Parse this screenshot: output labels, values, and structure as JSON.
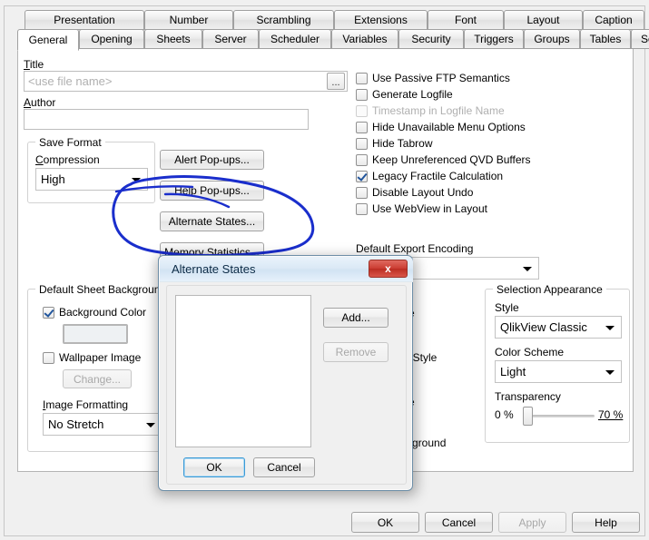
{
  "window": {
    "tabs_row1": [
      "Presentation",
      "Number",
      "Scrambling",
      "Extensions",
      "Font",
      "Layout",
      "Caption"
    ],
    "tabs_row2": [
      "General",
      "Opening",
      "Sheets",
      "Server",
      "Scheduler",
      "Variables",
      "Security",
      "Triggers",
      "Groups",
      "Tables",
      "Sort"
    ],
    "active_tab": "General"
  },
  "general": {
    "title_label": "Title",
    "title_placeholder": "<use file name>",
    "title_value": "",
    "browse_label": "...",
    "author_label": "Author",
    "author_value": "",
    "save_format": {
      "group_label": "Save Format",
      "compression_label": "Compression",
      "compression_value": "High"
    },
    "buttons": [
      "Alert Pop-ups...",
      "Help Pop-ups...",
      "Alternate States...",
      "Memory Statistics..."
    ]
  },
  "options": [
    {
      "label": "Use Passive FTP Semantics",
      "checked": false,
      "disabled": false
    },
    {
      "label": "Generate Logfile",
      "checked": false,
      "disabled": false
    },
    {
      "label": "Timestamp in Logfile Name",
      "checked": false,
      "disabled": true
    },
    {
      "label": "Hide Unavailable Menu Options",
      "checked": false,
      "disabled": false
    },
    {
      "label": "Hide Tabrow",
      "checked": false,
      "disabled": false
    },
    {
      "label": "Keep Unreferenced QVD Buffers",
      "checked": false,
      "disabled": false
    },
    {
      "label": "Legacy Fractile Calculation",
      "checked": true,
      "disabled": false
    },
    {
      "label": "Disable Layout Undo",
      "checked": false,
      "disabled": false
    },
    {
      "label": "Use WebView in Layout",
      "checked": false,
      "disabled": false
    }
  ],
  "export_encoding": {
    "label": "Default Export Encoding",
    "value": ""
  },
  "sheet_background": {
    "group_label": "Default Sheet Background",
    "background_color_label": "Background Color",
    "background_color_checked": true,
    "wallpaper_label": "Wallpaper Image",
    "wallpaper_checked": false,
    "change_label": "Change...",
    "change_disabled": true,
    "image_formatting_label": "Image Formatting",
    "image_formatting_value": "No Stretch"
  },
  "occluded_middle": {
    "label_1": "e",
    "label_2": "t Style",
    "label_3": "e",
    "label_4": "kground"
  },
  "selection_appearance": {
    "group_label": "Selection Appearance",
    "style_label": "Style",
    "style_value": "QlikView Classic",
    "color_scheme_label": "Color Scheme",
    "color_scheme_value": "Light",
    "transparency_label": "Transparency",
    "transparency_min": "0 %",
    "transparency_max": "70 %"
  },
  "dialog": {
    "title": "Alternate States",
    "close_label": "x",
    "add_label": "Add...",
    "remove_label": "Remove",
    "remove_disabled": true,
    "ok_label": "OK",
    "cancel_label": "Cancel",
    "list_items": []
  },
  "footer": {
    "ok_label": "OK",
    "cancel_label": "Cancel",
    "apply_label": "Apply",
    "apply_disabled": true,
    "help_label": "Help"
  },
  "annotation": {
    "color": "#1a2ecc",
    "shape": "hand-drawn-ellipse"
  }
}
